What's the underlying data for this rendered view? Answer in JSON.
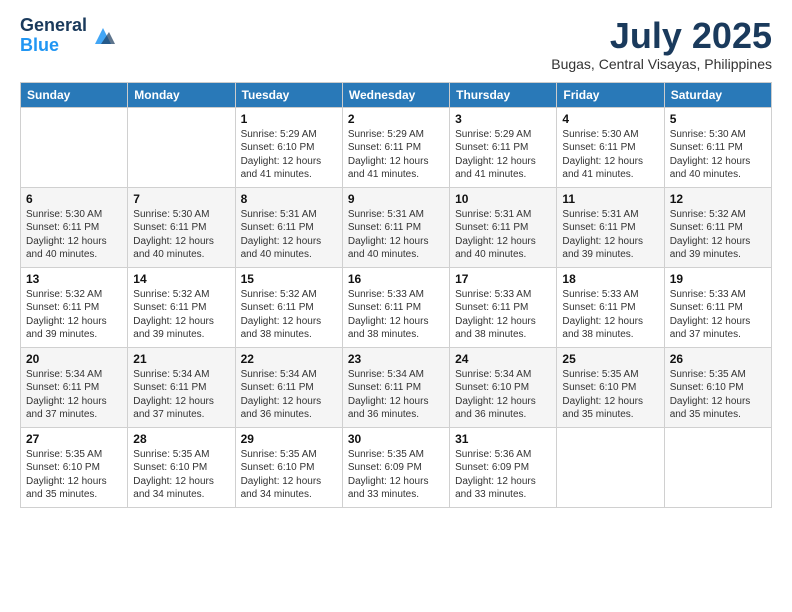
{
  "header": {
    "logo_general": "General",
    "logo_blue": "Blue",
    "month": "July 2025",
    "location": "Bugas, Central Visayas, Philippines"
  },
  "days_of_week": [
    "Sunday",
    "Monday",
    "Tuesday",
    "Wednesday",
    "Thursday",
    "Friday",
    "Saturday"
  ],
  "weeks": [
    [
      {
        "day": "",
        "info": ""
      },
      {
        "day": "",
        "info": ""
      },
      {
        "day": "1",
        "info": "Sunrise: 5:29 AM\nSunset: 6:10 PM\nDaylight: 12 hours and 41 minutes."
      },
      {
        "day": "2",
        "info": "Sunrise: 5:29 AM\nSunset: 6:11 PM\nDaylight: 12 hours and 41 minutes."
      },
      {
        "day": "3",
        "info": "Sunrise: 5:29 AM\nSunset: 6:11 PM\nDaylight: 12 hours and 41 minutes."
      },
      {
        "day": "4",
        "info": "Sunrise: 5:30 AM\nSunset: 6:11 PM\nDaylight: 12 hours and 41 minutes."
      },
      {
        "day": "5",
        "info": "Sunrise: 5:30 AM\nSunset: 6:11 PM\nDaylight: 12 hours and 40 minutes."
      }
    ],
    [
      {
        "day": "6",
        "info": "Sunrise: 5:30 AM\nSunset: 6:11 PM\nDaylight: 12 hours and 40 minutes."
      },
      {
        "day": "7",
        "info": "Sunrise: 5:30 AM\nSunset: 6:11 PM\nDaylight: 12 hours and 40 minutes."
      },
      {
        "day": "8",
        "info": "Sunrise: 5:31 AM\nSunset: 6:11 PM\nDaylight: 12 hours and 40 minutes."
      },
      {
        "day": "9",
        "info": "Sunrise: 5:31 AM\nSunset: 6:11 PM\nDaylight: 12 hours and 40 minutes."
      },
      {
        "day": "10",
        "info": "Sunrise: 5:31 AM\nSunset: 6:11 PM\nDaylight: 12 hours and 40 minutes."
      },
      {
        "day": "11",
        "info": "Sunrise: 5:31 AM\nSunset: 6:11 PM\nDaylight: 12 hours and 39 minutes."
      },
      {
        "day": "12",
        "info": "Sunrise: 5:32 AM\nSunset: 6:11 PM\nDaylight: 12 hours and 39 minutes."
      }
    ],
    [
      {
        "day": "13",
        "info": "Sunrise: 5:32 AM\nSunset: 6:11 PM\nDaylight: 12 hours and 39 minutes."
      },
      {
        "day": "14",
        "info": "Sunrise: 5:32 AM\nSunset: 6:11 PM\nDaylight: 12 hours and 39 minutes."
      },
      {
        "day": "15",
        "info": "Sunrise: 5:32 AM\nSunset: 6:11 PM\nDaylight: 12 hours and 38 minutes."
      },
      {
        "day": "16",
        "info": "Sunrise: 5:33 AM\nSunset: 6:11 PM\nDaylight: 12 hours and 38 minutes."
      },
      {
        "day": "17",
        "info": "Sunrise: 5:33 AM\nSunset: 6:11 PM\nDaylight: 12 hours and 38 minutes."
      },
      {
        "day": "18",
        "info": "Sunrise: 5:33 AM\nSunset: 6:11 PM\nDaylight: 12 hours and 38 minutes."
      },
      {
        "day": "19",
        "info": "Sunrise: 5:33 AM\nSunset: 6:11 PM\nDaylight: 12 hours and 37 minutes."
      }
    ],
    [
      {
        "day": "20",
        "info": "Sunrise: 5:34 AM\nSunset: 6:11 PM\nDaylight: 12 hours and 37 minutes."
      },
      {
        "day": "21",
        "info": "Sunrise: 5:34 AM\nSunset: 6:11 PM\nDaylight: 12 hours and 37 minutes."
      },
      {
        "day": "22",
        "info": "Sunrise: 5:34 AM\nSunset: 6:11 PM\nDaylight: 12 hours and 36 minutes."
      },
      {
        "day": "23",
        "info": "Sunrise: 5:34 AM\nSunset: 6:11 PM\nDaylight: 12 hours and 36 minutes."
      },
      {
        "day": "24",
        "info": "Sunrise: 5:34 AM\nSunset: 6:10 PM\nDaylight: 12 hours and 36 minutes."
      },
      {
        "day": "25",
        "info": "Sunrise: 5:35 AM\nSunset: 6:10 PM\nDaylight: 12 hours and 35 minutes."
      },
      {
        "day": "26",
        "info": "Sunrise: 5:35 AM\nSunset: 6:10 PM\nDaylight: 12 hours and 35 minutes."
      }
    ],
    [
      {
        "day": "27",
        "info": "Sunrise: 5:35 AM\nSunset: 6:10 PM\nDaylight: 12 hours and 35 minutes."
      },
      {
        "day": "28",
        "info": "Sunrise: 5:35 AM\nSunset: 6:10 PM\nDaylight: 12 hours and 34 minutes."
      },
      {
        "day": "29",
        "info": "Sunrise: 5:35 AM\nSunset: 6:10 PM\nDaylight: 12 hours and 34 minutes."
      },
      {
        "day": "30",
        "info": "Sunrise: 5:35 AM\nSunset: 6:09 PM\nDaylight: 12 hours and 33 minutes."
      },
      {
        "day": "31",
        "info": "Sunrise: 5:36 AM\nSunset: 6:09 PM\nDaylight: 12 hours and 33 minutes."
      },
      {
        "day": "",
        "info": ""
      },
      {
        "day": "",
        "info": ""
      }
    ]
  ]
}
